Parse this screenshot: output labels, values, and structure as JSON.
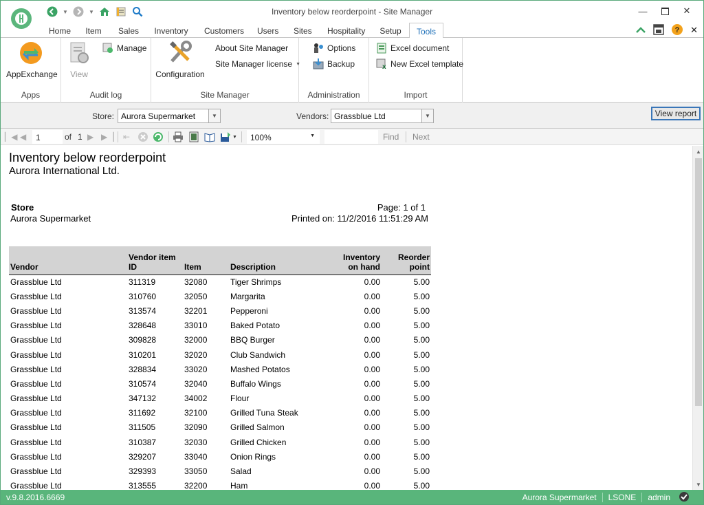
{
  "window": {
    "title": "Inventory below reorderpoint - Site Manager"
  },
  "ribbon_tabs": [
    "Home",
    "Item",
    "Sales",
    "Inventory",
    "Customers",
    "Users",
    "Sites",
    "Hospitality",
    "Setup",
    "Tools"
  ],
  "active_tab": "Tools",
  "ribbon": {
    "apps": {
      "label": "Apps",
      "appexchange": "AppExchange"
    },
    "audit": {
      "label": "Audit log",
      "view": "View",
      "manage": "Manage"
    },
    "sitemanager": {
      "label": "Site Manager",
      "configuration": "Configuration",
      "about": "About Site Manager",
      "license": "Site Manager license"
    },
    "administration": {
      "label": "Administration",
      "options": "Options",
      "backup": "Backup"
    },
    "import": {
      "label": "Import",
      "excel_document": "Excel document",
      "new_excel_template": "New Excel template"
    }
  },
  "filters": {
    "store_label": "Store:",
    "store_value": "Aurora Supermarket",
    "vendors_label": "Vendors:",
    "vendors_value": "Grassblue Ltd",
    "view_report": "View report"
  },
  "report_toolbar": {
    "page": "1",
    "of_label": "of",
    "total_pages": "1",
    "zoom": "100%",
    "find": "Find",
    "next": "Next"
  },
  "report": {
    "title": "Inventory below reorderpoint",
    "company": "Aurora International Ltd.",
    "store_label": "Store",
    "store_value": "Aurora Supermarket",
    "page_info": "Page: 1 of 1",
    "printed_on": "Printed on: 11/2/2016 11:51:29 AM",
    "columns": {
      "vendor": "Vendor",
      "vendor_item_id_1": "Vendor item",
      "vendor_item_id_2": "ID",
      "item": "Item",
      "description": "Description",
      "inventory_1": "Inventory",
      "inventory_2": "on hand",
      "reorder_1": "Reorder",
      "reorder_2": "point"
    },
    "rows": [
      [
        "Grassblue Ltd",
        "311319",
        "32080",
        "Tiger Shrimps",
        "0.00",
        "5.00"
      ],
      [
        "Grassblue Ltd",
        "310760",
        "32050",
        "Margarita",
        "0.00",
        "5.00"
      ],
      [
        "Grassblue Ltd",
        "313574",
        "32201",
        "Pepperoni",
        "0.00",
        "5.00"
      ],
      [
        "Grassblue Ltd",
        "328648",
        "33010",
        "Baked Potato",
        "0.00",
        "5.00"
      ],
      [
        "Grassblue Ltd",
        "309828",
        "32000",
        "BBQ Burger",
        "0.00",
        "5.00"
      ],
      [
        "Grassblue Ltd",
        "310201",
        "32020",
        "Club Sandwich",
        "0.00",
        "5.00"
      ],
      [
        "Grassblue Ltd",
        "328834",
        "33020",
        "Mashed Potatos",
        "0.00",
        "5.00"
      ],
      [
        "Grassblue Ltd",
        "310574",
        "32040",
        "Buffalo Wings",
        "0.00",
        "5.00"
      ],
      [
        "Grassblue Ltd",
        "347132",
        "34002",
        "Flour",
        "0.00",
        "5.00"
      ],
      [
        "Grassblue Ltd",
        "311692",
        "32100",
        "Grilled Tuna Steak",
        "0.00",
        "5.00"
      ],
      [
        "Grassblue Ltd",
        "311505",
        "32090",
        "Grilled Salmon",
        "0.00",
        "5.00"
      ],
      [
        "Grassblue Ltd",
        "310387",
        "32030",
        "Grilled Chicken",
        "0.00",
        "5.00"
      ],
      [
        "Grassblue Ltd",
        "329207",
        "33040",
        "Onion Rings",
        "0.00",
        "5.00"
      ],
      [
        "Grassblue Ltd",
        "329393",
        "33050",
        "Salad",
        "0.00",
        "5.00"
      ],
      [
        "Grassblue Ltd",
        "313555",
        "32200",
        "Ham",
        "0.00",
        "5.00"
      ]
    ]
  },
  "status": {
    "version": "v.9.8.2016.6669",
    "store": "Aurora Supermarket",
    "db": "LSONE",
    "user": "admin"
  },
  "colors": {
    "accent": "#59b57b",
    "tab_active_text": "#1d6fb8",
    "help": "#f3a21c"
  }
}
